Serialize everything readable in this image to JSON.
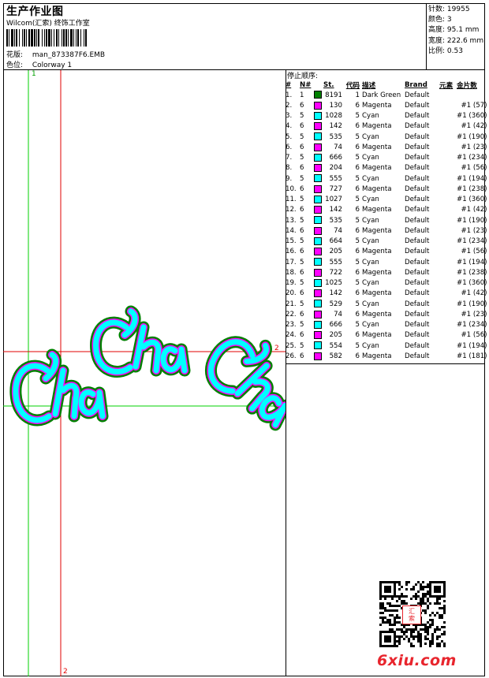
{
  "header": {
    "title": "生产作业图",
    "company": "Wilcom(汇索) 终饰工作室",
    "pattern_label": "花版:",
    "pattern_value": "man_873387F6.EMB",
    "colorway_label": "色位:",
    "colorway_value": "Colorway 1"
  },
  "specs": [
    {
      "label": "针数:",
      "value": "19955"
    },
    {
      "label": "颜色:",
      "value": "3"
    },
    {
      "label": "高度:",
      "value": "95.1 mm"
    },
    {
      "label": "宽度:",
      "value": "222.6 mm"
    },
    {
      "label": "比例:",
      "value": "0.53"
    }
  ],
  "stop_sequence": {
    "title": "停止顺序:",
    "headers": [
      "#",
      "N#",
      "St.",
      "代码",
      "描述",
      "Brand",
      "元素",
      "金片数"
    ],
    "rows": [
      {
        "idx": "1.",
        "n": "1",
        "color": "#008000",
        "st": "8191",
        "code": "1",
        "desc": "Dark Green",
        "brand": "Default",
        "seq": ""
      },
      {
        "idx": "2.",
        "n": "6",
        "color": "#ff00ff",
        "st": "130",
        "code": "6",
        "desc": "Magenta",
        "brand": "Default",
        "seq": "#1 (57)"
      },
      {
        "idx": "3.",
        "n": "5",
        "color": "#00ffff",
        "st": "1028",
        "code": "5",
        "desc": "Cyan",
        "brand": "Default",
        "seq": "#1 (360)"
      },
      {
        "idx": "4.",
        "n": "6",
        "color": "#ff00ff",
        "st": "142",
        "code": "6",
        "desc": "Magenta",
        "brand": "Default",
        "seq": "#1 (42)"
      },
      {
        "idx": "5.",
        "n": "5",
        "color": "#00ffff",
        "st": "535",
        "code": "5",
        "desc": "Cyan",
        "brand": "Default",
        "seq": "#1 (190)"
      },
      {
        "idx": "6.",
        "n": "6",
        "color": "#ff00ff",
        "st": "74",
        "code": "6",
        "desc": "Magenta",
        "brand": "Default",
        "seq": "#1 (23)"
      },
      {
        "idx": "7.",
        "n": "5",
        "color": "#00ffff",
        "st": "666",
        "code": "5",
        "desc": "Cyan",
        "brand": "Default",
        "seq": "#1 (234)"
      },
      {
        "idx": "8.",
        "n": "6",
        "color": "#ff00ff",
        "st": "204",
        "code": "6",
        "desc": "Magenta",
        "brand": "Default",
        "seq": "#1 (56)"
      },
      {
        "idx": "9.",
        "n": "5",
        "color": "#00ffff",
        "st": "555",
        "code": "5",
        "desc": "Cyan",
        "brand": "Default",
        "seq": "#1 (194)"
      },
      {
        "idx": "10.",
        "n": "6",
        "color": "#ff00ff",
        "st": "727",
        "code": "6",
        "desc": "Magenta",
        "brand": "Default",
        "seq": "#1 (238)"
      },
      {
        "idx": "11.",
        "n": "5",
        "color": "#00ffff",
        "st": "1027",
        "code": "5",
        "desc": "Cyan",
        "brand": "Default",
        "seq": "#1 (360)"
      },
      {
        "idx": "12.",
        "n": "6",
        "color": "#ff00ff",
        "st": "142",
        "code": "6",
        "desc": "Magenta",
        "brand": "Default",
        "seq": "#1 (42)"
      },
      {
        "idx": "13.",
        "n": "5",
        "color": "#00ffff",
        "st": "535",
        "code": "5",
        "desc": "Cyan",
        "brand": "Default",
        "seq": "#1 (190)"
      },
      {
        "idx": "14.",
        "n": "6",
        "color": "#ff00ff",
        "st": "74",
        "code": "6",
        "desc": "Magenta",
        "brand": "Default",
        "seq": "#1 (23)"
      },
      {
        "idx": "15.",
        "n": "5",
        "color": "#00ffff",
        "st": "664",
        "code": "5",
        "desc": "Cyan",
        "brand": "Default",
        "seq": "#1 (234)"
      },
      {
        "idx": "16.",
        "n": "6",
        "color": "#ff00ff",
        "st": "205",
        "code": "6",
        "desc": "Magenta",
        "brand": "Default",
        "seq": "#1 (56)"
      },
      {
        "idx": "17.",
        "n": "5",
        "color": "#00ffff",
        "st": "555",
        "code": "5",
        "desc": "Cyan",
        "brand": "Default",
        "seq": "#1 (194)"
      },
      {
        "idx": "18.",
        "n": "6",
        "color": "#ff00ff",
        "st": "722",
        "code": "6",
        "desc": "Magenta",
        "brand": "Default",
        "seq": "#1 (238)"
      },
      {
        "idx": "19.",
        "n": "5",
        "color": "#00ffff",
        "st": "1025",
        "code": "5",
        "desc": "Cyan",
        "brand": "Default",
        "seq": "#1 (360)"
      },
      {
        "idx": "20.",
        "n": "6",
        "color": "#ff00ff",
        "st": "142",
        "code": "6",
        "desc": "Magenta",
        "brand": "Default",
        "seq": "#1 (42)"
      },
      {
        "idx": "21.",
        "n": "5",
        "color": "#00ffff",
        "st": "529",
        "code": "5",
        "desc": "Cyan",
        "brand": "Default",
        "seq": "#1 (190)"
      },
      {
        "idx": "22.",
        "n": "6",
        "color": "#ff00ff",
        "st": "74",
        "code": "6",
        "desc": "Magenta",
        "brand": "Default",
        "seq": "#1 (23)"
      },
      {
        "idx": "23.",
        "n": "5",
        "color": "#00ffff",
        "st": "666",
        "code": "5",
        "desc": "Cyan",
        "brand": "Default",
        "seq": "#1 (234)"
      },
      {
        "idx": "24.",
        "n": "6",
        "color": "#ff00ff",
        "st": "205",
        "code": "6",
        "desc": "Magenta",
        "brand": "Default",
        "seq": "#1 (56)"
      },
      {
        "idx": "25.",
        "n": "5",
        "color": "#00ffff",
        "st": "554",
        "code": "5",
        "desc": "Cyan",
        "brand": "Default",
        "seq": "#1 (194)"
      },
      {
        "idx": "26.",
        "n": "6",
        "color": "#ff00ff",
        "st": "582",
        "code": "6",
        "desc": "Magenta",
        "brand": "Default",
        "seq": "#1 (181)"
      }
    ]
  },
  "design": {
    "text": "Cha Cha Cha",
    "colors": {
      "outline": "#008000",
      "fill": "#00ffff",
      "accent": "#ff00ff"
    }
  },
  "guides": {
    "v1_label": "1",
    "v2_label": "2",
    "h_label": "2",
    "guide_color": "#00d000",
    "marker_color": "#e00000"
  },
  "watermark": {
    "logo_text": "6xiu.com",
    "seal_text": "汇索",
    "logo_color": "#e8252d"
  }
}
